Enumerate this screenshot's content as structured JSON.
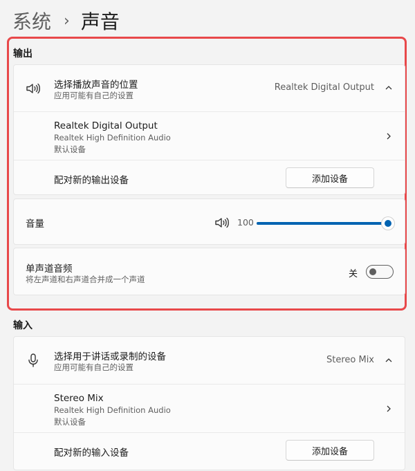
{
  "breadcrumb": {
    "parent": "系统",
    "separator": "›",
    "current": "声音"
  },
  "output": {
    "section_label": "输出",
    "choose_output": {
      "title": "选择播放声音的位置",
      "subtitle": "应用可能有自己的设置",
      "value": "Realtek Digital Output",
      "icon": "speaker-icon",
      "expanded": true
    },
    "device": {
      "name": "Realtek Digital Output",
      "driver": "Realtek High Definition Audio",
      "default_label": "默认设备"
    },
    "pair": {
      "title": "配对新的输出设备",
      "button_label": "添加设备"
    },
    "volume": {
      "label": "音量",
      "value": "100",
      "level": 1.0,
      "icon": "speaker-volume-icon"
    },
    "mono": {
      "title": "单声道音频",
      "subtitle": "将左声道和右声道合并成一个声道",
      "state_label": "关",
      "on": false
    }
  },
  "input": {
    "section_label": "输入",
    "choose_input": {
      "title": "选择用于讲话或录制的设备",
      "subtitle": "应用可能有自己的设置",
      "value": "Stereo Mix",
      "icon": "microphone-icon",
      "expanded": true
    },
    "device": {
      "name": "Stereo Mix",
      "driver": "Realtek High Definition Audio",
      "default_label": "默认设备"
    },
    "pair": {
      "title": "配对新的输入设备",
      "button_label": "添加设备"
    }
  },
  "colors": {
    "accent": "#0063b1",
    "highlight_border": "#e8484a",
    "background": "#f3f3f3"
  }
}
